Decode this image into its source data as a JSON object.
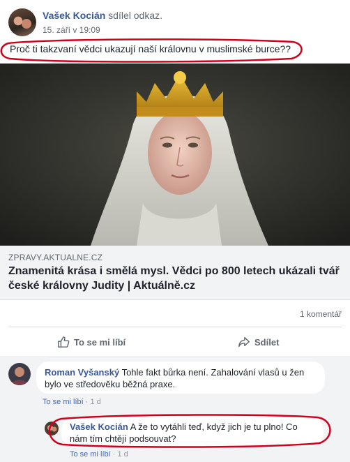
{
  "post": {
    "author": "Vašek Kocián",
    "action": "sdílel odkaz.",
    "time": "15. září v 19:09",
    "text": "Proč ti takzvaní vědci ukazují naší královnu v muslimské burce??"
  },
  "link_preview": {
    "domain": "ZPRAVY.AKTUALNE.CZ",
    "title": "Znamenitá krása i smělá mysl. Vědci po 800 letech ukázali tvář české královny Judity | Aktuálně.cz"
  },
  "stats": {
    "comments": "1 komentář"
  },
  "actions": {
    "like_label": "To se mi líbí",
    "share_label": "Sdílet"
  },
  "comments": [
    {
      "name": "Roman Vyšanský",
      "text": "Tohle fakt bůrka není. Zahalování vlasů u žen bylo ve středověku běžná praxe.",
      "like_label": "To se mi líbí",
      "sep": "·",
      "age": "1 d"
    },
    {
      "name": "Vašek Kocián",
      "text": "A že to vytáhli teď, když jich je tu plno! Co nám tím chtějí podsouvat?",
      "like_label": "To se mi líbí",
      "sep": "·",
      "age": "1 d"
    }
  ],
  "colors": {
    "link": "#385898",
    "annotation": "#d0021b",
    "background": "#f2f3f5"
  },
  "icons": {
    "like": "thumbs-up-icon",
    "share": "share-arrow-icon"
  }
}
